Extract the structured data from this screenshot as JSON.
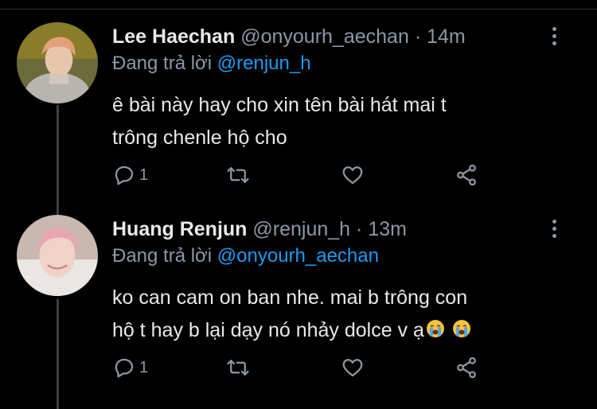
{
  "tweets": [
    {
      "name": "Lee Haechan",
      "handle": "@onyourh_aechan",
      "separator": "·",
      "time": "14m",
      "replying_prefix": "Đang trả lời",
      "replying_to": "@renjun_h",
      "text_line1": "ê bài này hay cho xin tên bài hát mai t",
      "text_line2": "trông chenle hộ cho",
      "reply_count": "1"
    },
    {
      "name": "Huang Renjun",
      "handle": "@renjun_h",
      "separator": "·",
      "time": "13m",
      "replying_prefix": "Đang trả lời",
      "replying_to": "@onyourh_aechan",
      "text_line1": "ko can cam on ban nhe. mai b trông con",
      "text_line2": "hộ t hay b lại dạy nó nhảy dolce v ạ",
      "reply_count": "1"
    }
  ],
  "icons": {
    "reply": "reply-icon",
    "retweet": "retweet-icon",
    "like": "heart-icon",
    "share": "share-icon",
    "more": "more-options-icon",
    "emoji": "loudly-crying-face-emoji"
  },
  "colors": {
    "background": "#000000",
    "text_primary": "#e7e9ea",
    "text_secondary": "#8b98a5",
    "mention": "#1d9bf0"
  }
}
